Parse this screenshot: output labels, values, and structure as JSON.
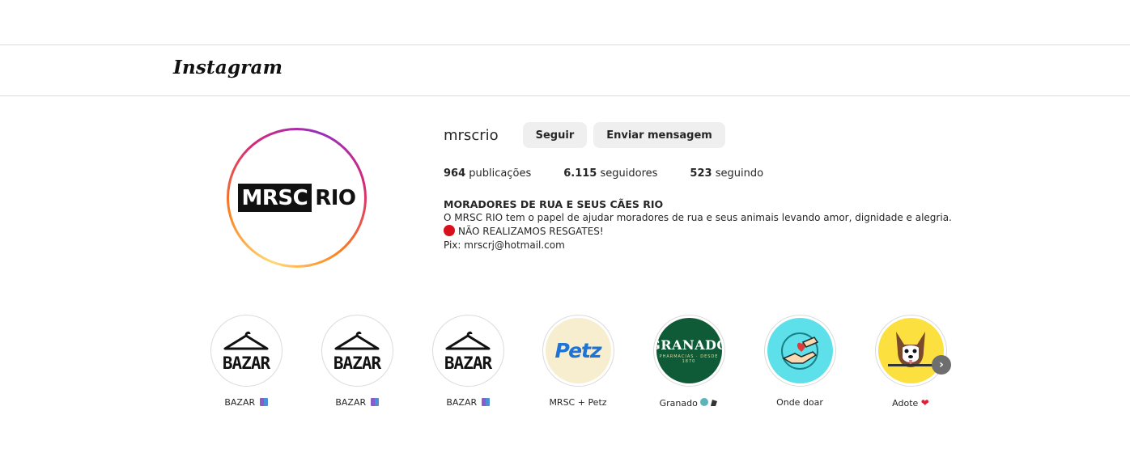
{
  "nav": {
    "logo": "Instagram"
  },
  "profile": {
    "username": "mrscrio",
    "follow_label": "Seguir",
    "message_label": "Enviar mensagem",
    "avatar_logo": {
      "left": "MRSC",
      "right": "RIO"
    },
    "stats": {
      "posts_count": "964",
      "posts_label": "publicações",
      "followers_count": "6.115",
      "followers_label": "seguidores",
      "following_count": "523",
      "following_label": "seguindo"
    },
    "bio": {
      "name": "MORADORES DE RUA E SEUS CÃES RIO",
      "line1": "O MRSC RIO tem o papel de ajudar moradores de rua e seus animais levando amor, dignidade e alegria.",
      "line2": "NÃO REALIZAMOS RESGATES!",
      "line3": "Pix: mrscrj@hotmail.com"
    }
  },
  "highlights": [
    {
      "label": "BAZAR",
      "cover_text": "BAZAR",
      "emoji": "shopping-bags-icon"
    },
    {
      "label": "BAZAR",
      "cover_text": "BAZAR",
      "emoji": "shopping-bags-icon"
    },
    {
      "label": "BAZAR",
      "cover_text": "BAZAR",
      "emoji": "shopping-bags-icon"
    },
    {
      "label": "MRSC + Petz",
      "cover_text": "Petz"
    },
    {
      "label": "Granado",
      "cover_text": "GRANADO",
      "cover_sub": "PHARMACIAS · DESDE 1870",
      "emoji": "soap-icon"
    },
    {
      "label": "Onde doar",
      "emoji": "heart-hand-icon"
    },
    {
      "label": "Adote",
      "emoji": "heart-icon"
    }
  ],
  "colors": {
    "button_bg": "#efefef",
    "border": "#dbdbdb",
    "granado": "#0f5b37",
    "petz_blue": "#1e74d6"
  }
}
